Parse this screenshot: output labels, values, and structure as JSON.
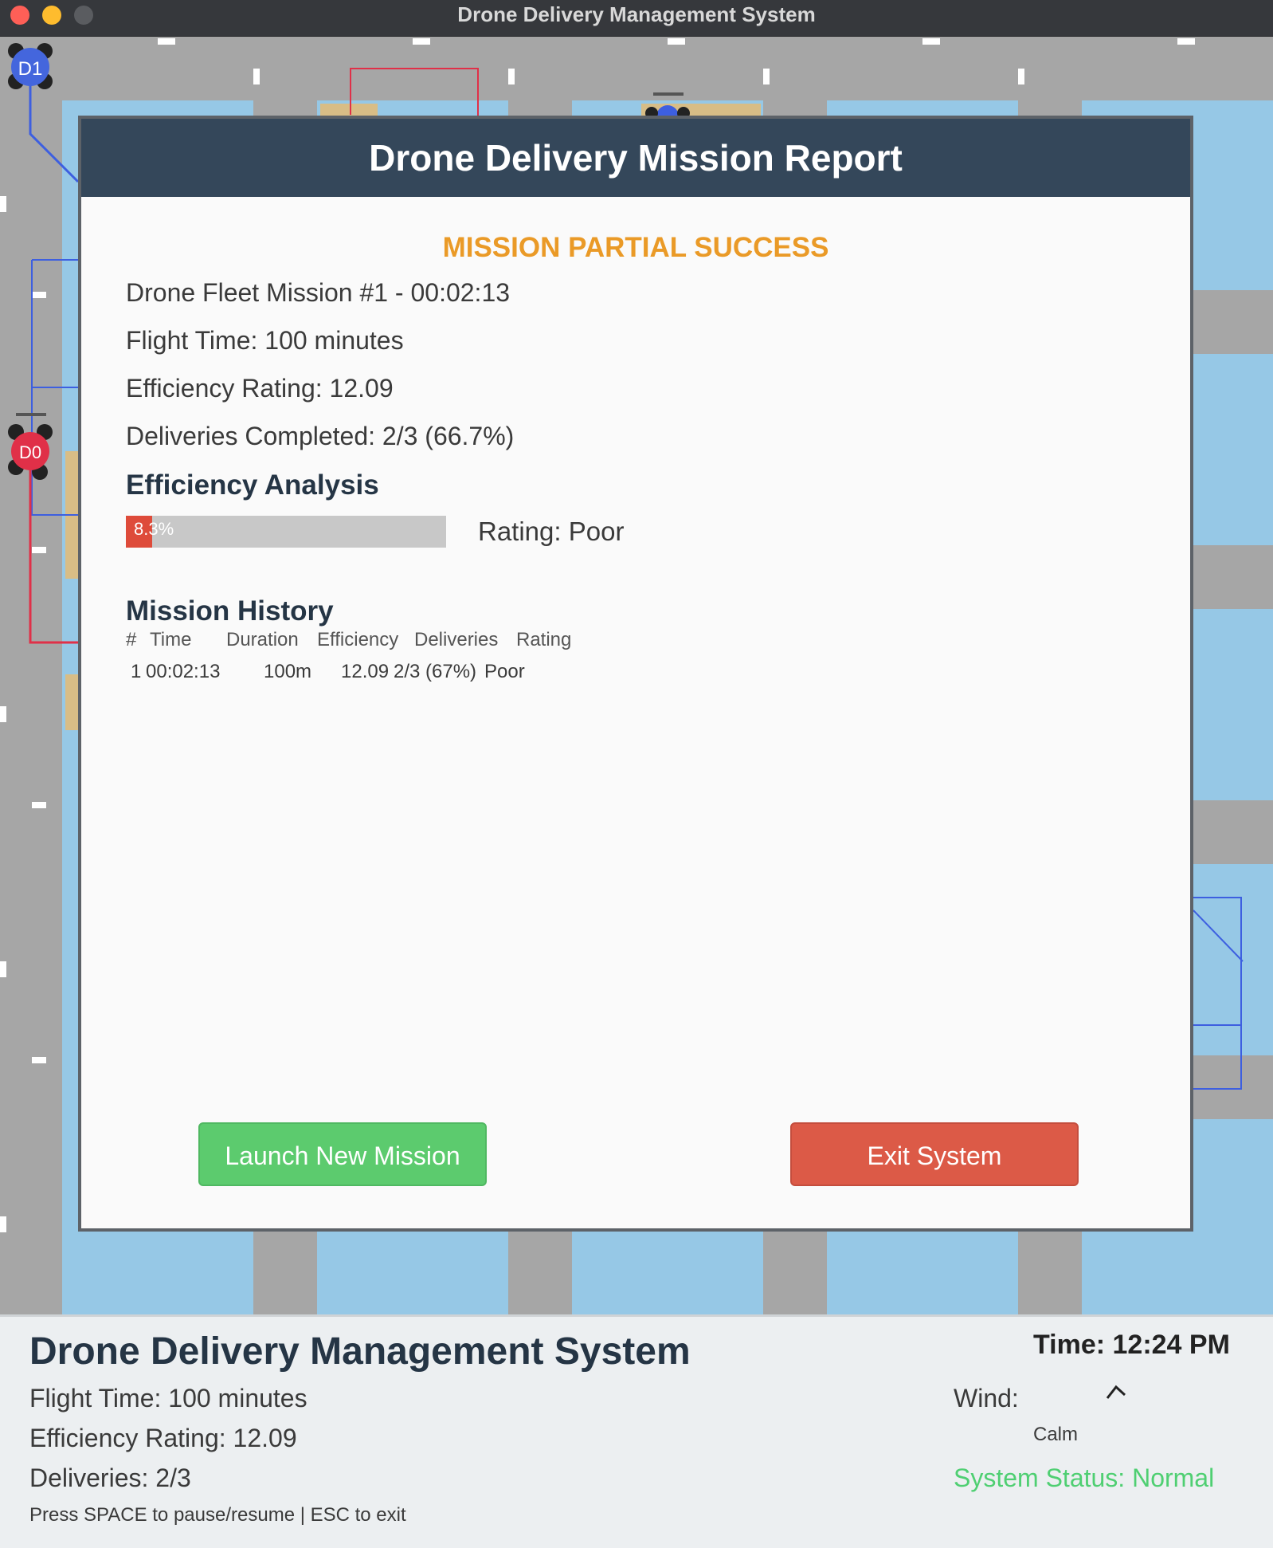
{
  "window": {
    "title": "Drone Delivery Management System"
  },
  "map": {
    "drones": [
      {
        "label": "D1",
        "color": "#4466dd"
      },
      {
        "label": "D0",
        "color": "#e03048"
      }
    ]
  },
  "report": {
    "title": "Drone Delivery Mission Report",
    "status": "MISSION PARTIAL SUCCESS",
    "mission_line": "Drone Fleet Mission #1 - 00:02:13",
    "flight_time": "Flight Time: 100 minutes",
    "efficiency_rating": "Efficiency Rating: 12.09",
    "deliveries": "Deliveries Completed: 2/3 (66.7%)",
    "analysis_title": "Efficiency Analysis",
    "efficiency_percent": 8.3,
    "efficiency_percent_label": "8.3%",
    "rating_text": "Rating: Poor",
    "history_title": "Mission History",
    "history_headers": [
      "#",
      "Time",
      "Duration",
      "Efficiency",
      "Deliveries",
      "Rating"
    ],
    "history_rows": [
      {
        "num": "1",
        "time": "00:02:13",
        "duration": "100m",
        "efficiency": "12.09",
        "deliveries": "2/3 (67%)",
        "rating": "Poor"
      }
    ],
    "launch_button": "Launch New Mission",
    "exit_button": "Exit System"
  },
  "panel": {
    "title": "Drone Delivery Management System",
    "flight_time": "Flight Time: 100 minutes",
    "efficiency": "Efficiency Rating: 12.09",
    "deliveries": "Deliveries: 2/3",
    "hint": "Press SPACE to pause/resume | ESC to exit",
    "time": "Time: 12:24 PM",
    "wind_label": "Wind:",
    "wind_value": "Calm",
    "system_status": "System Status: Normal"
  },
  "colors": {
    "header_bg": "#34475a",
    "status_orange": "#ea9a27",
    "launch_green": "#5ccb6e",
    "exit_red": "#dc5a47",
    "status_green": "#4fcf72",
    "water_blue": "#96c8e6"
  }
}
